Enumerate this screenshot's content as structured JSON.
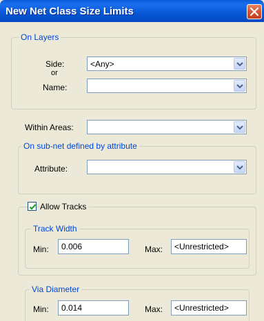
{
  "window": {
    "title": "New Net Class Size Limits"
  },
  "on_layers": {
    "title": "On Layers",
    "side_label": "Side:",
    "or_label": "or",
    "name_label": "Name:",
    "side_value": "<Any>",
    "name_value": ""
  },
  "within_areas": {
    "label": "Within Areas:",
    "value": ""
  },
  "sub_net": {
    "title": "On sub-net defined by attribute",
    "attribute_label": "Attribute:",
    "attribute_value": ""
  },
  "tracks": {
    "allow_label": "Allow Tracks",
    "allow_checked": true,
    "track_width_title": "Track Width",
    "min_label": "Min:",
    "min_value": "0.006",
    "max_label": "Max:",
    "max_value": "<Unrestricted>"
  },
  "via": {
    "title": "Via Diameter",
    "min_label": "Min:",
    "min_value": "0.014",
    "max_label": "Max:",
    "max_value": "<Unrestricted>"
  },
  "colors": {
    "title_bar": "#0656D4",
    "group_title": "#0046D5",
    "dialog_bg": "#ECE9D8"
  }
}
